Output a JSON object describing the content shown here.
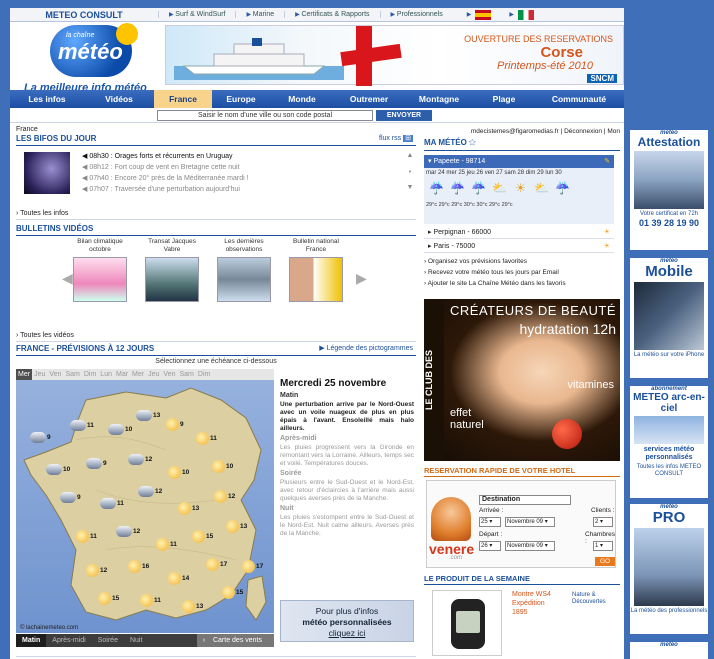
{
  "topbar": {
    "brand": "METEO CONSULT",
    "links": [
      "Surf & WindSurf",
      "Marine",
      "Certificats & Rapports",
      "Professionnels"
    ]
  },
  "header": {
    "logo_small": "la chaîne",
    "logo_big": "météo",
    "tagline": "La meilleure info météo",
    "banner": {
      "line1": "OUVERTURE DES RESERVATIONS",
      "line2": "Corse",
      "line3": "Printemps-été 2010",
      "brand": "SNCM"
    }
  },
  "nav": {
    "items": [
      "Les infos",
      "Vidéos",
      "France",
      "Europe",
      "Monde",
      "Outremer",
      "Montagne",
      "Plage",
      "Communauté"
    ],
    "active_index": 2
  },
  "search": {
    "placeholder": "Saisir le nom d'une ville ou son code postal",
    "button": "ENVOYER"
  },
  "breadcrumb": "France",
  "bifos": {
    "title": "LES BIFOS DU JOUR",
    "rss": "flux rss",
    "items": [
      "08h30 : Orages forts et récurrents en Uruguay",
      "08h12 : Fort coup de vent en Bretagne cette nuit",
      "07h40 : Encore 20° près de la Méditerranée mardi !",
      "07h07 : Traversée d'une perturbation aujourd'hui"
    ],
    "all": "Toutes les infos"
  },
  "videos": {
    "title": "BULLETINS VIDÉOS",
    "items": [
      {
        "label": "Bilan climatique octobre"
      },
      {
        "label": "Transat Jacques Vabre"
      },
      {
        "label": "Les dernières observations"
      },
      {
        "label": "Bulletin national France"
      }
    ],
    "all": "Toutes les vidéos"
  },
  "previsions": {
    "title": "FRANCE - PRÉVISIONS À 12 JOURS",
    "legend": "Légende des pictogrammes",
    "select_hint": "Sélectionnez une échéance ci-dessous",
    "days": [
      "Mer",
      "Jeu",
      "Ven",
      "Sam",
      "Dim",
      "Lun",
      "Mar",
      "Mer",
      "Jeu",
      "Ven",
      "Sam",
      "Dim"
    ],
    "active_day": 0,
    "map_credit": "© lachainemeteo.com",
    "map_temps": [
      {
        "v": "9"
      },
      {
        "v": "11"
      },
      {
        "v": "10"
      },
      {
        "v": "13"
      },
      {
        "v": "9"
      },
      {
        "v": "11"
      },
      {
        "v": "10"
      },
      {
        "v": "9"
      },
      {
        "v": "12"
      },
      {
        "v": "10"
      },
      {
        "v": "10"
      },
      {
        "v": "9"
      },
      {
        "v": "11"
      },
      {
        "v": "12"
      },
      {
        "v": "13"
      },
      {
        "v": "12"
      },
      {
        "v": "11"
      },
      {
        "v": "12"
      },
      {
        "v": "11"
      },
      {
        "v": "15"
      },
      {
        "v": "13"
      },
      {
        "v": "12"
      },
      {
        "v": "16"
      },
      {
        "v": "14"
      },
      {
        "v": "17"
      },
      {
        "v": "15"
      },
      {
        "v": "11"
      },
      {
        "v": "13"
      },
      {
        "v": "15"
      },
      {
        "v": "17"
      }
    ],
    "periods": [
      "Matin",
      "Après-midi",
      "Soirée",
      "Nuit"
    ],
    "active_period": 0,
    "map_link": "Carte des vents",
    "forecast": {
      "date": "Mercredi 25 novembre",
      "matin_label": "Matin",
      "matin_text": "Une perturbation arrive par le Nord-Ouest avec un voile nuageux de plus en plus épais à l'avant. Ensoleillé mais halo ailleurs.",
      "apres_label": "Après-midi",
      "apres_text": "Les pluies progressent vers la Gironde en remontant vers la Lorraine. Ailleurs, temps sec et voilé. Températures douces.",
      "soir_label": "Soirée",
      "soir_text": "Plusieurs entre le Sud-Ouest et le Nord-Est, avec retour d'éclaircies à l'arrière mais aussi quelques averses près de la Manche.",
      "nuit_label": "Nuit",
      "nuit_text": "Les pluies s'estompent entre le Sud-Ouest et le Nord-Est. Nuit calme ailleurs. Averses près de la Manche."
    },
    "infobox": {
      "l1": "Pour plus d'infos",
      "l2": "météo personnalisées",
      "l3": "cliquez ici"
    }
  },
  "ma_meteo": {
    "user": "mdecistemes@figaromedias.fr",
    "logout": "Déconnexion",
    "mon": "Mon",
    "title": "MA MÉTÉO",
    "city1": "Papeete - 98714",
    "days": [
      "mar 24",
      "mer 25",
      "jeu 26",
      "ven 27",
      "sam 28",
      "dim 29",
      "lun 30"
    ],
    "temps": [
      "29°c",
      "29°c",
      "29°c",
      "30°c",
      "30°c",
      "29°c",
      "29°c"
    ],
    "icons": [
      "rain",
      "rain",
      "rain",
      "partly",
      "sun",
      "partly",
      "rain"
    ],
    "city2": "Perpignan - 66000",
    "city3": "Paris - 75000",
    "links": [
      "Organisez vos prévisions favorites",
      "Recevez votre météo tous les jours par Email",
      "Ajouter le site La Chaîne Météo dans les favoris"
    ]
  },
  "ad_beaute": {
    "side": "LE CLUB DES",
    "l1": "CRÉATEURS DE BEAUTÉ",
    "l2": "hydratation 12h",
    "l3": "vitamines",
    "l4a": "effet",
    "l4b": "naturel"
  },
  "hotel": {
    "title": "RESERVATION RAPIDE DE VOTRE HOTEL",
    "destination": "Destination",
    "arrivee": "Arrivée :",
    "depart": "Départ :",
    "clients": "Clients :",
    "chambres": "Chambres :",
    "arr_day": "25",
    "arr_month": "Novembre 09",
    "dep_day": "26",
    "dep_month": "Novembre 09",
    "clients_val": "2",
    "chambres_val": "1",
    "go": "GO",
    "brand": "venere",
    "brand_com": ".com"
  },
  "produit": {
    "title": "LE PRODUIT DE LA SEMAINE",
    "l1": "Montre WS4",
    "l2": "Expédition",
    "l3": "1895",
    "brand": "Nature & Découvertes"
  },
  "sidebar_ads": [
    {
      "head": "météo",
      "big": "Attestation",
      "foot": "Votre certificat en 72h",
      "num": "01 39 28 19 90"
    },
    {
      "head": "météo",
      "big": "Mobile",
      "foot": "La météo sur votre iPhone"
    },
    {
      "head": "abonnement",
      "big": "METEO arc-en-ciel",
      "foot": "services météo personnalisés",
      "num": "Toutes les infos METEO CONSULT"
    },
    {
      "head": "météo",
      "big": "PRO",
      "foot": "La météo des professionnels"
    },
    {
      "head": "météo"
    }
  ],
  "colors": {
    "brand_blue": "#1a4f9a",
    "nav_active": "#f7d38c",
    "page_bg": "#3e6fb8",
    "hotel_orange": "#d26a14"
  }
}
